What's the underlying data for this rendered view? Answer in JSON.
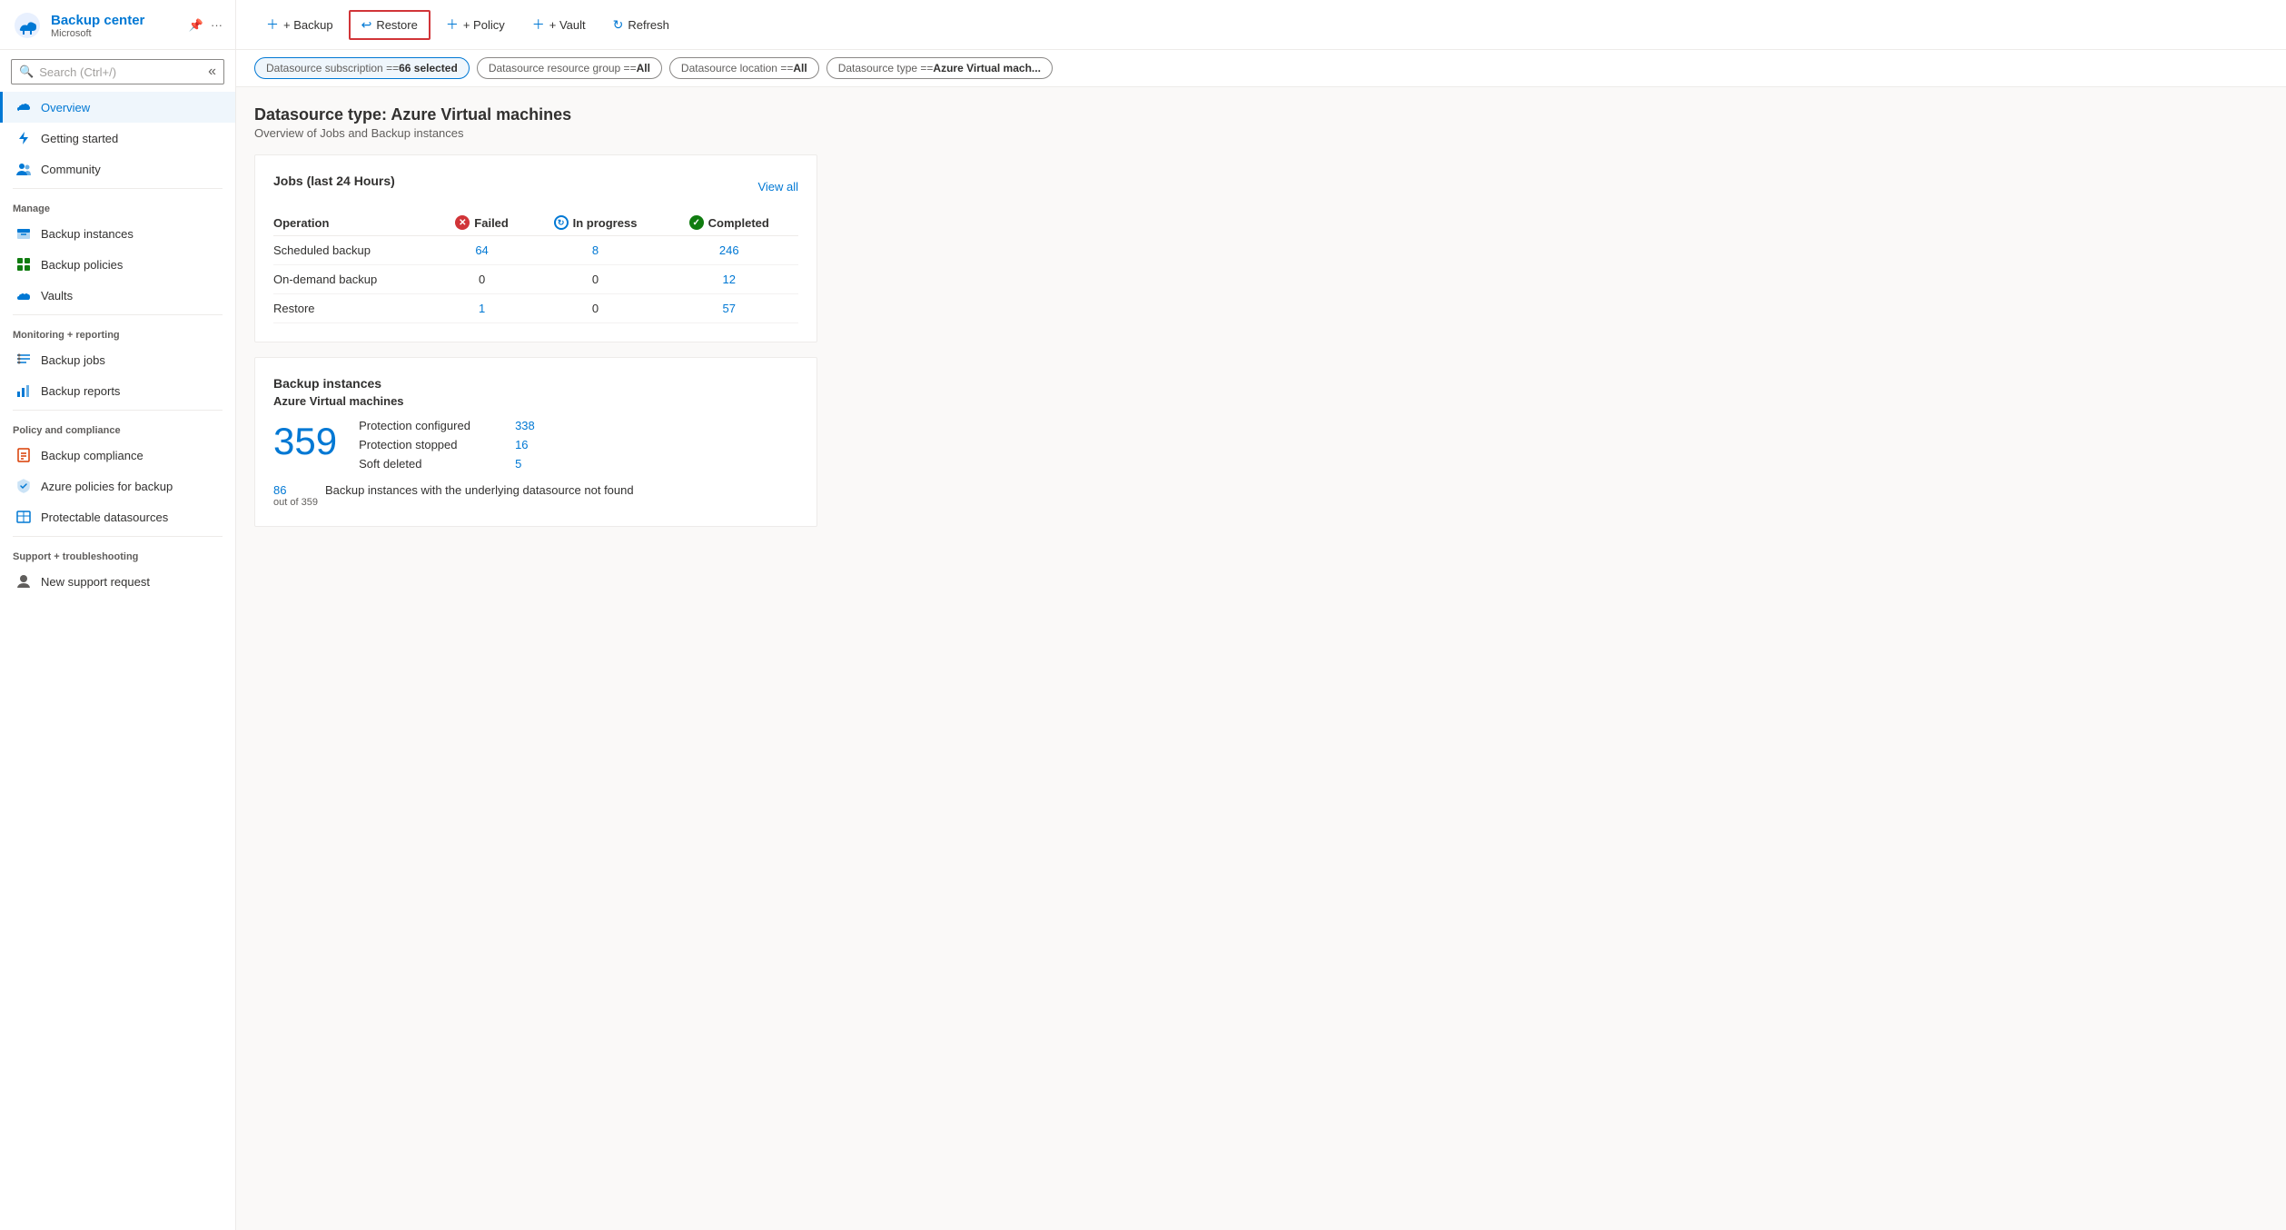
{
  "sidebar": {
    "app_title": "Backup center",
    "app_sub": "Microsoft",
    "search_placeholder": "Search (Ctrl+/)",
    "collapse_icon": "«",
    "nav_items": [
      {
        "id": "overview",
        "label": "Overview",
        "active": true,
        "icon": "cloud-icon"
      },
      {
        "id": "getting-started",
        "label": "Getting started",
        "active": false,
        "icon": "lightning-icon"
      },
      {
        "id": "community",
        "label": "Community",
        "active": false,
        "icon": "people-icon"
      },
      {
        "id": "manage-section",
        "label": "Manage",
        "type": "section"
      },
      {
        "id": "backup-instances",
        "label": "Backup instances",
        "active": false,
        "icon": "box-icon"
      },
      {
        "id": "backup-policies",
        "label": "Backup policies",
        "active": false,
        "icon": "grid-icon"
      },
      {
        "id": "vaults",
        "label": "Vaults",
        "active": false,
        "icon": "cloud2-icon"
      },
      {
        "id": "monitoring-section",
        "label": "Monitoring + reporting",
        "type": "section"
      },
      {
        "id": "backup-jobs",
        "label": "Backup jobs",
        "active": false,
        "icon": "list-icon"
      },
      {
        "id": "backup-reports",
        "label": "Backup reports",
        "active": false,
        "icon": "chart-icon"
      },
      {
        "id": "policy-section",
        "label": "Policy and compliance",
        "type": "section"
      },
      {
        "id": "backup-compliance",
        "label": "Backup compliance",
        "active": false,
        "icon": "doc-icon"
      },
      {
        "id": "azure-policies",
        "label": "Azure policies for backup",
        "active": false,
        "icon": "shield-icon"
      },
      {
        "id": "protectable-datasources",
        "label": "Protectable datasources",
        "active": false,
        "icon": "table-icon"
      },
      {
        "id": "support-section",
        "label": "Support + troubleshooting",
        "type": "section"
      },
      {
        "id": "new-support",
        "label": "New support request",
        "active": false,
        "icon": "person-icon"
      }
    ]
  },
  "toolbar": {
    "backup_label": "+ Backup",
    "restore_label": "Restore",
    "policy_label": "+ Policy",
    "vault_label": "+ Vault",
    "refresh_label": "Refresh"
  },
  "filters": [
    {
      "key": "Datasource subscription == ",
      "val": "66 selected",
      "style": "primary"
    },
    {
      "key": "Datasource resource group == ",
      "val": "All",
      "style": "secondary"
    },
    {
      "key": "Datasource location == ",
      "val": "All",
      "style": "secondary"
    },
    {
      "key": "Datasource type == ",
      "val": "Azure Virtual mach...",
      "style": "secondary"
    }
  ],
  "page": {
    "title": "Datasource type: Azure Virtual machines",
    "subtitle": "Overview of Jobs and Backup instances"
  },
  "jobs_card": {
    "title": "Jobs (last 24 Hours)",
    "view_all": "View all",
    "columns": [
      "Operation",
      "Failed",
      "In progress",
      "Completed"
    ],
    "rows": [
      {
        "operation": "Scheduled backup",
        "failed": "64",
        "in_progress": "8",
        "completed": "246"
      },
      {
        "operation": "On-demand backup",
        "failed": "0",
        "in_progress": "0",
        "completed": "12"
      },
      {
        "operation": "Restore",
        "failed": "1",
        "in_progress": "0",
        "completed": "57"
      }
    ]
  },
  "backup_instances_card": {
    "title": "Backup instances",
    "subtitle": "Azure Virtual machines",
    "big_number": "359",
    "stats": [
      {
        "label": "Protection configured",
        "value": "338"
      },
      {
        "label": "Protection stopped",
        "value": "16"
      },
      {
        "label": "Soft deleted",
        "value": "5"
      }
    ],
    "footer_number": "86",
    "footer_sub": "out of 359",
    "footer_text": "Backup instances with the underlying datasource not found"
  }
}
